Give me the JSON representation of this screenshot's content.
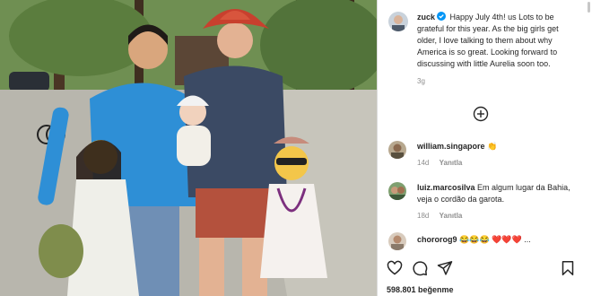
{
  "post": {
    "author": "zuck",
    "caption": "Happy July 4th! us Lots to be grateful for this year. As the big girls get older, I love talking to them about why America is so great. Looking forward to discussing with little Aurelia soon too.",
    "time_ago": "3g"
  },
  "comments": [
    {
      "username": "william.singapore",
      "text": "👏",
      "time_ago": "14d",
      "reply_label": "Yanıtla"
    },
    {
      "username": "luiz.marcosilva",
      "text": "Em algum lugar da Bahia, veja o cordão da garota.",
      "time_ago": "18d",
      "reply_label": "Yanıtla"
    },
    {
      "username": "chororog9",
      "text": "😂😂😂 ❤️❤️❤️ ...",
      "time_ago": "",
      "reply_label": ""
    }
  ],
  "likes": "598.801 beğenme",
  "icons": {
    "like": "heart-icon",
    "comment": "comment-icon",
    "share": "send-icon",
    "save": "bookmark-icon",
    "load_more": "plus-circle-icon",
    "verified": "verified-badge-icon"
  },
  "colors": {
    "verified_blue": "#0095f6",
    "username_text": "#262626",
    "meta_text": "#8e8e8e"
  }
}
